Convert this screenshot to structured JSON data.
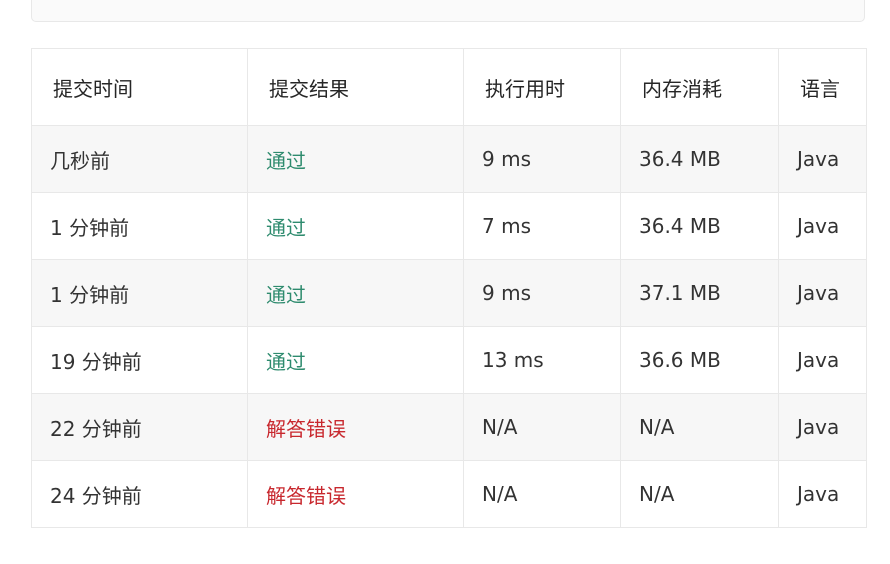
{
  "colors": {
    "pass": "#2e8b6e",
    "fail": "#c8282e",
    "border": "#e8e8e8",
    "stripe": "#f7f7f7"
  },
  "table": {
    "headers": [
      "提交时间",
      "提交结果",
      "执行用时",
      "内存消耗",
      "语言"
    ],
    "rows": [
      {
        "time": "几秒前",
        "result": "通过",
        "status": "pass",
        "runtime": "9 ms",
        "memory": "36.4 MB",
        "language": "Java"
      },
      {
        "time": "1 分钟前",
        "result": "通过",
        "status": "pass",
        "runtime": "7 ms",
        "memory": "36.4 MB",
        "language": "Java"
      },
      {
        "time": "1 分钟前",
        "result": "通过",
        "status": "pass",
        "runtime": "9 ms",
        "memory": "37.1 MB",
        "language": "Java"
      },
      {
        "time": "19 分钟前",
        "result": "通过",
        "status": "pass",
        "runtime": "13 ms",
        "memory": "36.6 MB",
        "language": "Java"
      },
      {
        "time": "22 分钟前",
        "result": "解答错误",
        "status": "fail",
        "runtime": "N/A",
        "memory": "N/A",
        "language": "Java"
      },
      {
        "time": "24 分钟前",
        "result": "解答错误",
        "status": "fail",
        "runtime": "N/A",
        "memory": "N/A",
        "language": "Java"
      }
    ]
  }
}
